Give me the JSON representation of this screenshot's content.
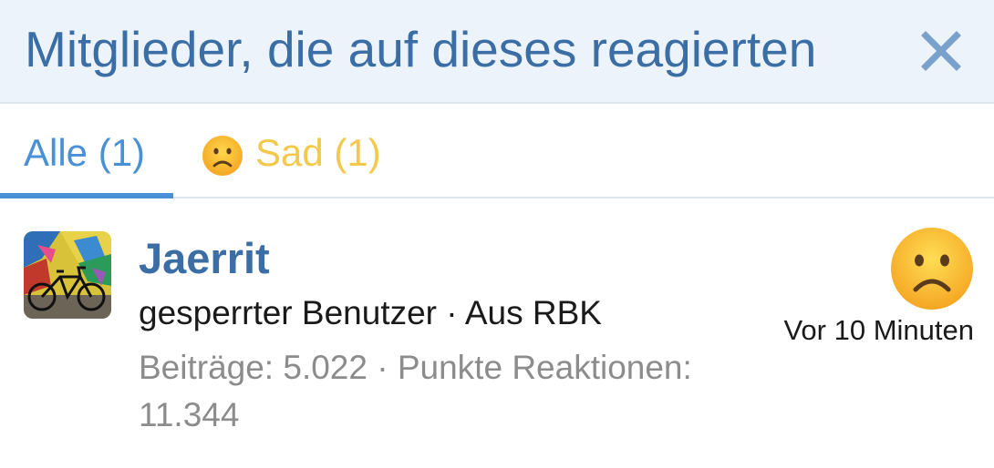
{
  "header": {
    "title": "Mitglieder, die auf dieses reagierten",
    "close_icon": "close-icon"
  },
  "tabs": [
    {
      "label": "Alle (1)",
      "active": true,
      "color": "#4a90d6"
    },
    {
      "label": "Sad (1)",
      "icon": "sad-face-icon",
      "active": false,
      "color": "#f2c94a"
    }
  ],
  "members": [
    {
      "name": "Jaerrit",
      "avatar": "avatar-bicycle-graffiti",
      "title": "gesperrter Benutzer · Aus RBK",
      "stats": "Beiträge: 5.022 · Punkte Reaktionen: 11.344",
      "reaction": "sad-face-icon",
      "time": "Vor 10 Minuten"
    }
  ],
  "colors": {
    "accent": "#3a6ea5",
    "tab_active": "#4a90d6",
    "sad": "#f2c94a",
    "header_bg": "#edf3fa"
  }
}
